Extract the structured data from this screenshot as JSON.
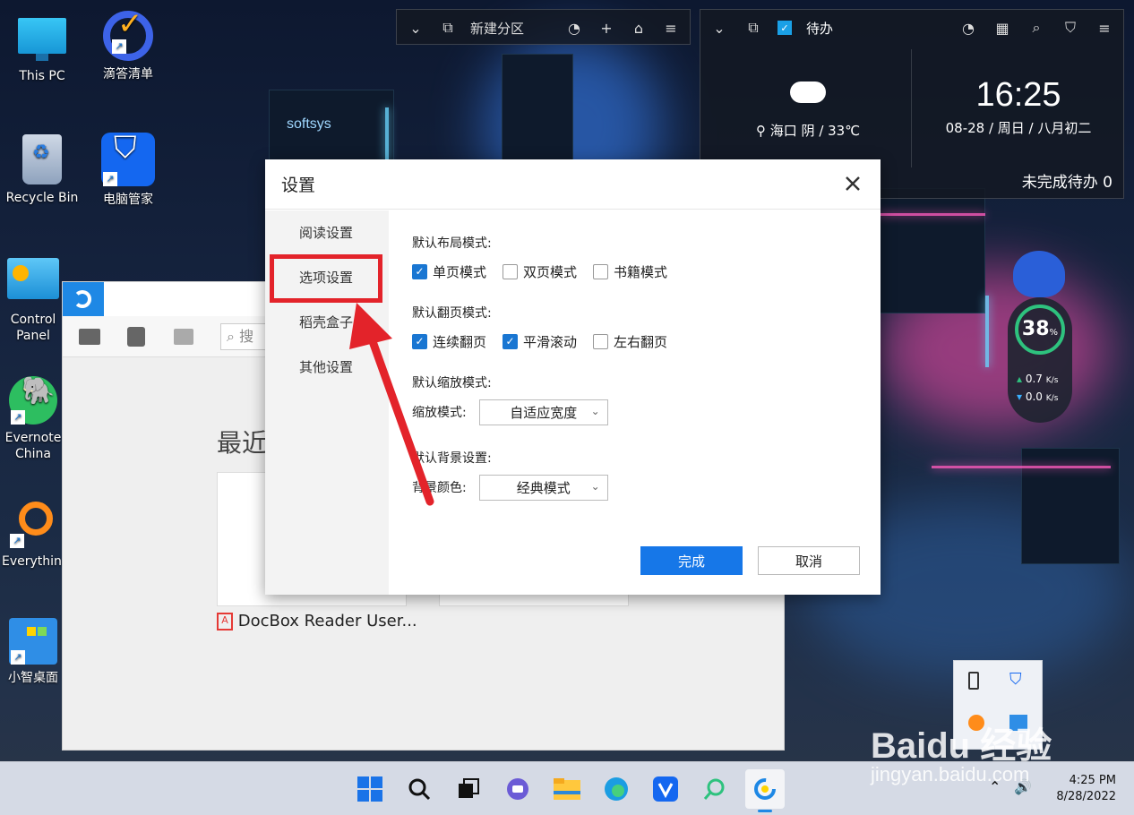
{
  "desktop": {
    "icons": [
      {
        "label": "This PC"
      },
      {
        "label": "滴答清单"
      },
      {
        "label": "Recycle Bin"
      },
      {
        "label": "电脑管家"
      },
      {
        "label": "Control Panel"
      },
      {
        "label": "Evernote China"
      },
      {
        "label": "Everything"
      },
      {
        "label": "小智桌面"
      }
    ]
  },
  "widget_left": {
    "partition_label": "新建分区"
  },
  "widget_right": {
    "todo_label": "待办",
    "location": "海口 阴 / 33℃",
    "time": "16:25",
    "date": "08-28 / 周日 / 八月初二",
    "pending": "未完成待办 0"
  },
  "speed_widget": {
    "percent": "38",
    "percent_unit": "%",
    "up": "0.7",
    "down": "0.0",
    "unit": "K/s"
  },
  "reader": {
    "search_placeholder": "搜",
    "recent_heading": "最近",
    "recent_file": "DocBox Reader User..."
  },
  "dialog": {
    "title": "设置",
    "side_items": [
      "阅读设置",
      "选项设置",
      "稻壳盒子",
      "其他设置"
    ],
    "layout": {
      "title": "默认布局模式:",
      "options": [
        {
          "label": "单页模式",
          "checked": true
        },
        {
          "label": "双页模式",
          "checked": false
        },
        {
          "label": "书籍模式",
          "checked": false
        }
      ]
    },
    "paging": {
      "title": "默认翻页模式:",
      "options": [
        {
          "label": "连续翻页",
          "checked": true
        },
        {
          "label": "平滑滚动",
          "checked": true
        },
        {
          "label": "左右翻页",
          "checked": false
        }
      ]
    },
    "zoom": {
      "title": "默认缩放模式:",
      "label": "缩放模式:",
      "value": "自适应宽度"
    },
    "background": {
      "title": "默认背景设置:",
      "label": "背景颜色:",
      "value": "经典模式"
    },
    "ok_label": "完成",
    "cancel_label": "取消"
  },
  "taskbar": {
    "time": "4:25 PM",
    "date": "8/28/2022"
  },
  "watermark": {
    "brand": "Baidu 经验",
    "url": "jingyan.baidu.com"
  },
  "colors": {
    "accent": "#1677e8",
    "annotation": "#e3232a"
  }
}
